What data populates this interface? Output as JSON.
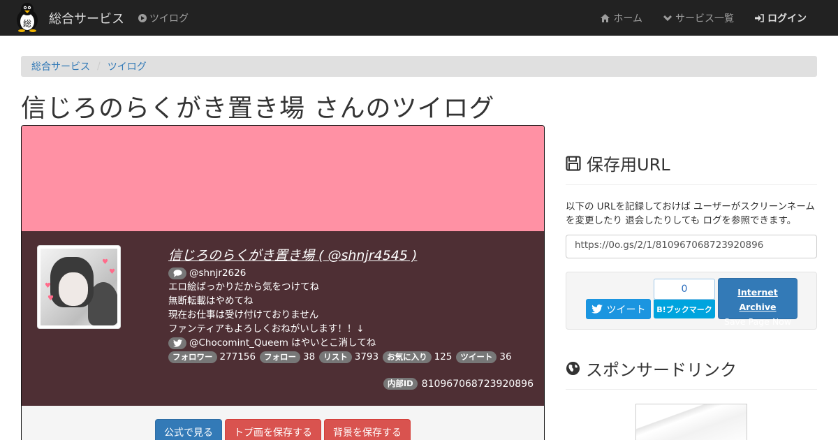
{
  "nav": {
    "brand": "総合サービス",
    "brand_logo_char": "総",
    "left_link": "ツイログ",
    "right": [
      {
        "label": "ホーム",
        "icon": "home-icon"
      },
      {
        "label": "サービス一覧",
        "icon": "chevron-down-icon"
      },
      {
        "label": "ログイン",
        "icon": "sign-in-icon"
      }
    ]
  },
  "breadcrumb": {
    "items": [
      "総合サービス",
      "ツイログ"
    ],
    "separator": "/"
  },
  "title": "信じろのらくがき置き場 さんのツイログ",
  "profile": {
    "banner_color": "#ff91a4",
    "bg_color": "#4e2f34",
    "name": "信じろのらくがき置き場 ( @shnjr4545 )",
    "comment_handle": "@shnjr2626",
    "bio": [
      "エロ絵ばっかりだから気をつけてね",
      "無断転載はやめてね",
      "現在お仕事は受け付けておりません",
      "ファンティアもよろしくおねがいします！！↓"
    ],
    "twitter_line": "@Chocomint_Queem はやいとこ消してね",
    "stats": [
      {
        "label": "フォロワー",
        "value": "277156"
      },
      {
        "label": "フォロー",
        "value": "38"
      },
      {
        "label": "リスト",
        "value": "3793"
      },
      {
        "label": "お気に入り",
        "value": "125"
      },
      {
        "label": "ツイート",
        "value": "36"
      }
    ],
    "internal_label": "内部ID",
    "internal_id": "810967068723920896"
  },
  "actions": {
    "official": "公式で見る",
    "save_top": "トプ画を保存する",
    "save_bg": "背景を保存する"
  },
  "sidebar": {
    "save_heading": "保存用URL",
    "save_desc": "以下の URLを記録しておけば ユーザーがスクリーンネームを変更したり 退会したりしても ログを参照できます。",
    "save_url": "https://0o.gs/2/1/810967068723920896",
    "tweet_label": "ツイート",
    "hatena_count": "0",
    "hatena_label": "B!ブックマーク",
    "ia_title": "Internet Archive",
    "ia_sub": "Save Page Now",
    "sponsor_heading": "スポンサードリンク"
  }
}
